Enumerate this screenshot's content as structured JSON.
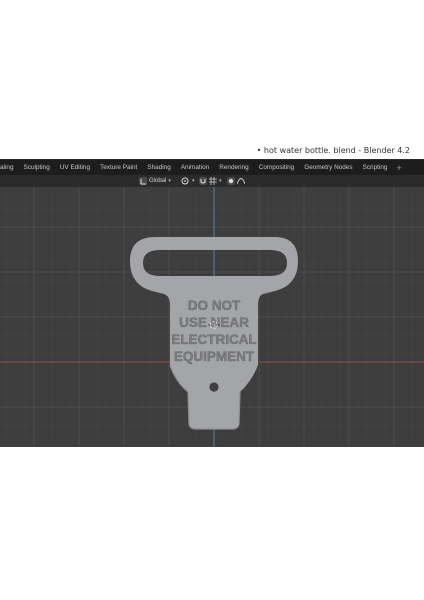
{
  "window": {
    "title": "• hot water bottle. blend - Blender 4.2"
  },
  "workspace_tabs": [
    "aling",
    "Sculpting",
    "UV Editing",
    "Texture Paint",
    "Shading",
    "Animation",
    "Rendering",
    "Compositing",
    "Geometry Nodes",
    "Scripting"
  ],
  "workspace_add": "+",
  "viewport_header": {
    "orientation": "Global"
  },
  "model": {
    "text_lines": [
      "DO NOT",
      "USE NEAR",
      "ELECTRICAL",
      "EQUIPMENT"
    ],
    "fill_color": "#a4a5a8",
    "text_color": "#7c7d80"
  },
  "colors": {
    "viewport_bg": "#3d3d3d",
    "grid_minor": "#474747",
    "grid_major": "#525252",
    "x_axis": "#9b4b50",
    "y_axis": "#5a7e33",
    "cursor": "#5b8fbf"
  }
}
